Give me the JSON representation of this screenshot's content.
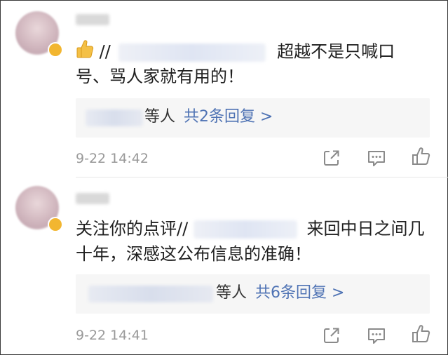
{
  "comments": [
    {
      "prefix": "//",
      "text_after_mention": "超越不是只喊口",
      "text_line2": "号、骂人家就有用的！",
      "reply_suffix": "等人",
      "reply_link": "共2条回复 >",
      "time": "9-22 14:42"
    },
    {
      "text_line1_before": "关注你的点评//",
      "text_after_mention": "来回中日之间几",
      "text_line2": "十年，深感这公布信息的准确！",
      "reply_suffix": "等人",
      "reply_link": "共6条回复 >",
      "time": "9-22 14:41"
    }
  ],
  "icons": {
    "emoji": "thumbs-up-emoji",
    "share": "share-icon",
    "comment": "comment-icon",
    "like": "like-icon"
  },
  "colors": {
    "link": "#4f73b4",
    "time": "#999999",
    "icon": "#8a8a8a",
    "reply_bg": "#f6f6f6"
  }
}
